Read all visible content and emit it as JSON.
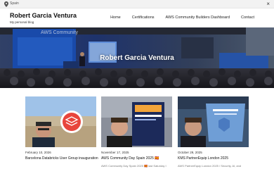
{
  "topbar": {
    "location_icon": "map-pin-icon",
    "location": "Spain",
    "close_icon": "close-icon",
    "close_glyph": "×"
  },
  "header": {
    "site_title": "Robert Garcia Ventura",
    "tagline": "My personal blog",
    "nav": [
      {
        "label": "Home"
      },
      {
        "label": "Certifications"
      },
      {
        "label": "AWS Community Builders Dashboard"
      },
      {
        "label": "Contact"
      }
    ]
  },
  "hero": {
    "title": "Robert Garcia Ventura",
    "background_text": "AWS Community"
  },
  "posts": [
    {
      "date": "February 10, 2026",
      "title": "Barcelona Databricks User Group inauguration",
      "excerpt": ""
    },
    {
      "date": "November 17, 2025",
      "title": "AWS Community Day Spain 2025 🇪🇸",
      "excerpt": "AWS Community Day Spain 2025 🇪🇸 last Saturday I"
    },
    {
      "date": "October 29, 2025",
      "title": "KMS PartnerEquip London 2025",
      "excerpt": "AWS PartnerEquip London 2025 / Security, AI, and"
    }
  ],
  "colors": {
    "accent_blue": "#1f6fd1",
    "hero_dark": "#1c2a55",
    "topbar_bg": "#f2f2f2"
  }
}
